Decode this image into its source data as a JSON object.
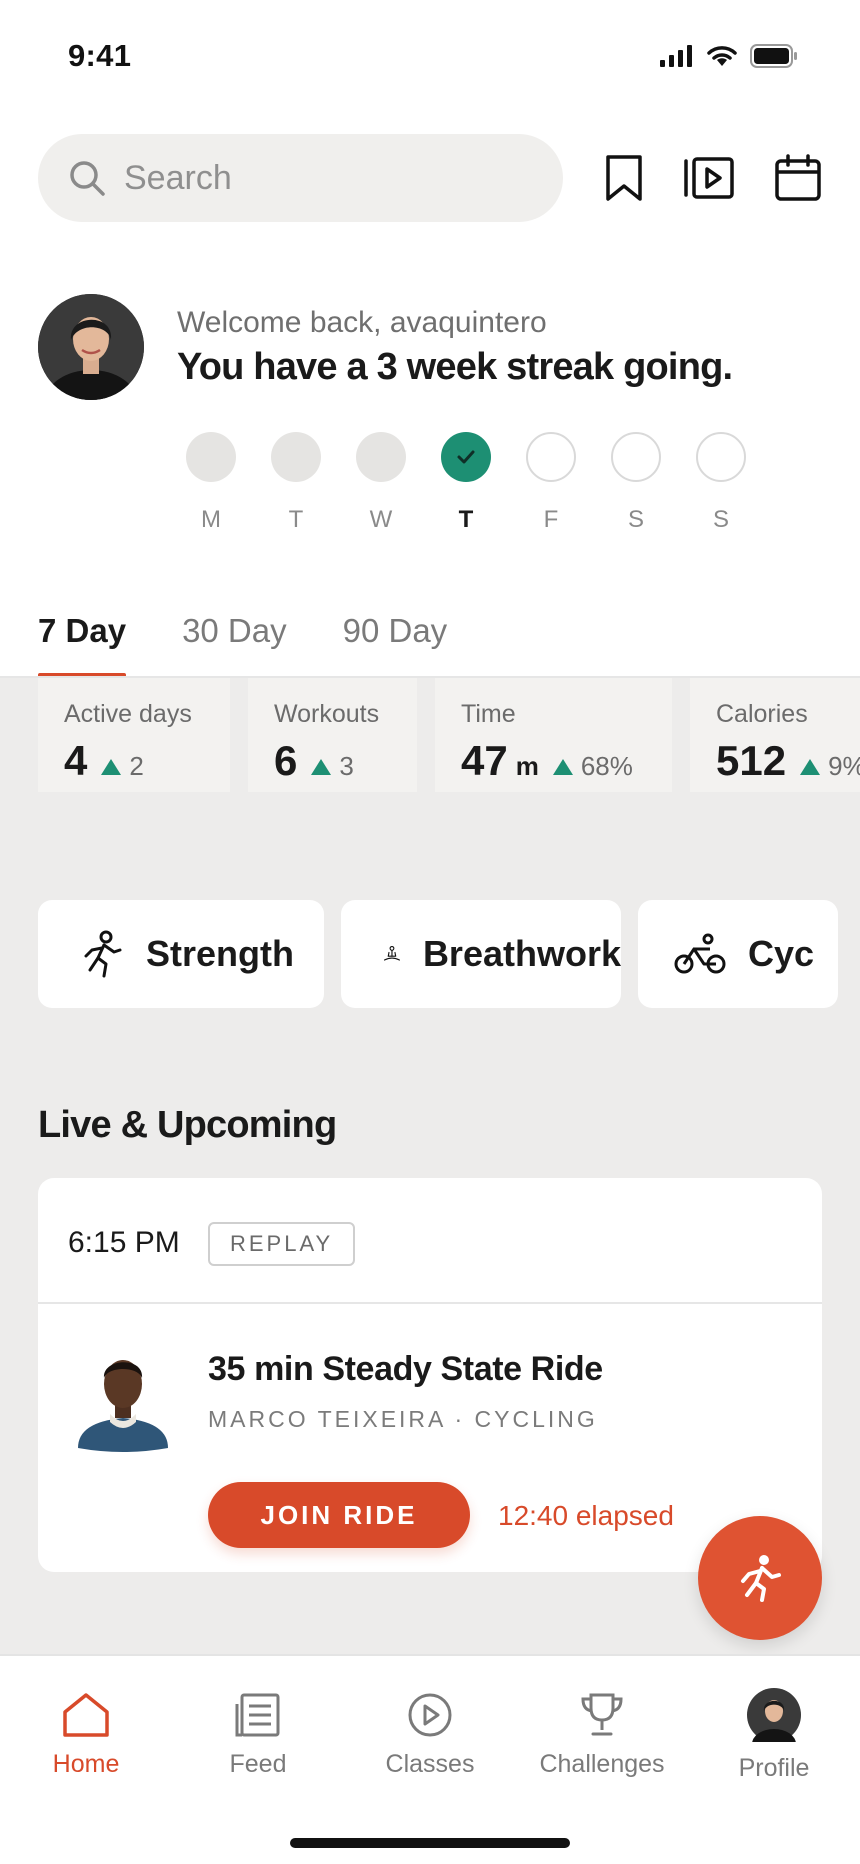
{
  "status_bar": {
    "time": "9:41"
  },
  "search": {
    "placeholder": "Search"
  },
  "welcome": {
    "subtitle": "Welcome back, avaquintero",
    "title": "You have a 3 week streak going."
  },
  "week": {
    "days": [
      {
        "label": "M",
        "state": "done"
      },
      {
        "label": "T",
        "state": "done"
      },
      {
        "label": "W",
        "state": "done"
      },
      {
        "label": "T",
        "state": "today"
      },
      {
        "label": "F",
        "state": "future"
      },
      {
        "label": "S",
        "state": "future"
      },
      {
        "label": "S",
        "state": "future"
      }
    ]
  },
  "tabs": [
    {
      "label": "7 Day",
      "active": true
    },
    {
      "label": "30 Day",
      "active": false
    },
    {
      "label": "90 Day",
      "active": false
    }
  ],
  "stats": [
    {
      "label": "Active days",
      "value": "4",
      "unit": "",
      "delta": "2"
    },
    {
      "label": "Workouts",
      "value": "6",
      "unit": "",
      "delta": "3"
    },
    {
      "label": "Time",
      "value": "47",
      "unit": "m",
      "delta": "68%"
    },
    {
      "label": "Calories",
      "value": "512",
      "unit": "",
      "delta": "9%"
    }
  ],
  "categories": [
    {
      "label": "Strength",
      "icon": "strength-icon"
    },
    {
      "label": "Breathwork",
      "icon": "meditation-icon"
    },
    {
      "label": "Cyc",
      "icon": "bike-icon"
    }
  ],
  "live_section": {
    "title": "Live & Upcoming",
    "card": {
      "time": "6:15 PM",
      "badge": "REPLAY",
      "class_title": "35 min Steady State Ride",
      "meta": "MARCO TEIXEIRA · CYCLING",
      "join_label": "JOIN RIDE",
      "elapsed": "12:40 elapsed"
    }
  },
  "bottom_nav": [
    {
      "label": "Home",
      "icon": "home-icon",
      "active": true
    },
    {
      "label": "Feed",
      "icon": "feed-icon",
      "active": false
    },
    {
      "label": "Classes",
      "icon": "play-circle-icon",
      "active": false
    },
    {
      "label": "Challenges",
      "icon": "trophy-icon",
      "active": false
    },
    {
      "label": "Profile",
      "icon": "avatar",
      "active": false
    }
  ],
  "colors": {
    "accent": "#d84a2a",
    "success": "#1d8f73",
    "section_bg": "#edeceb"
  }
}
